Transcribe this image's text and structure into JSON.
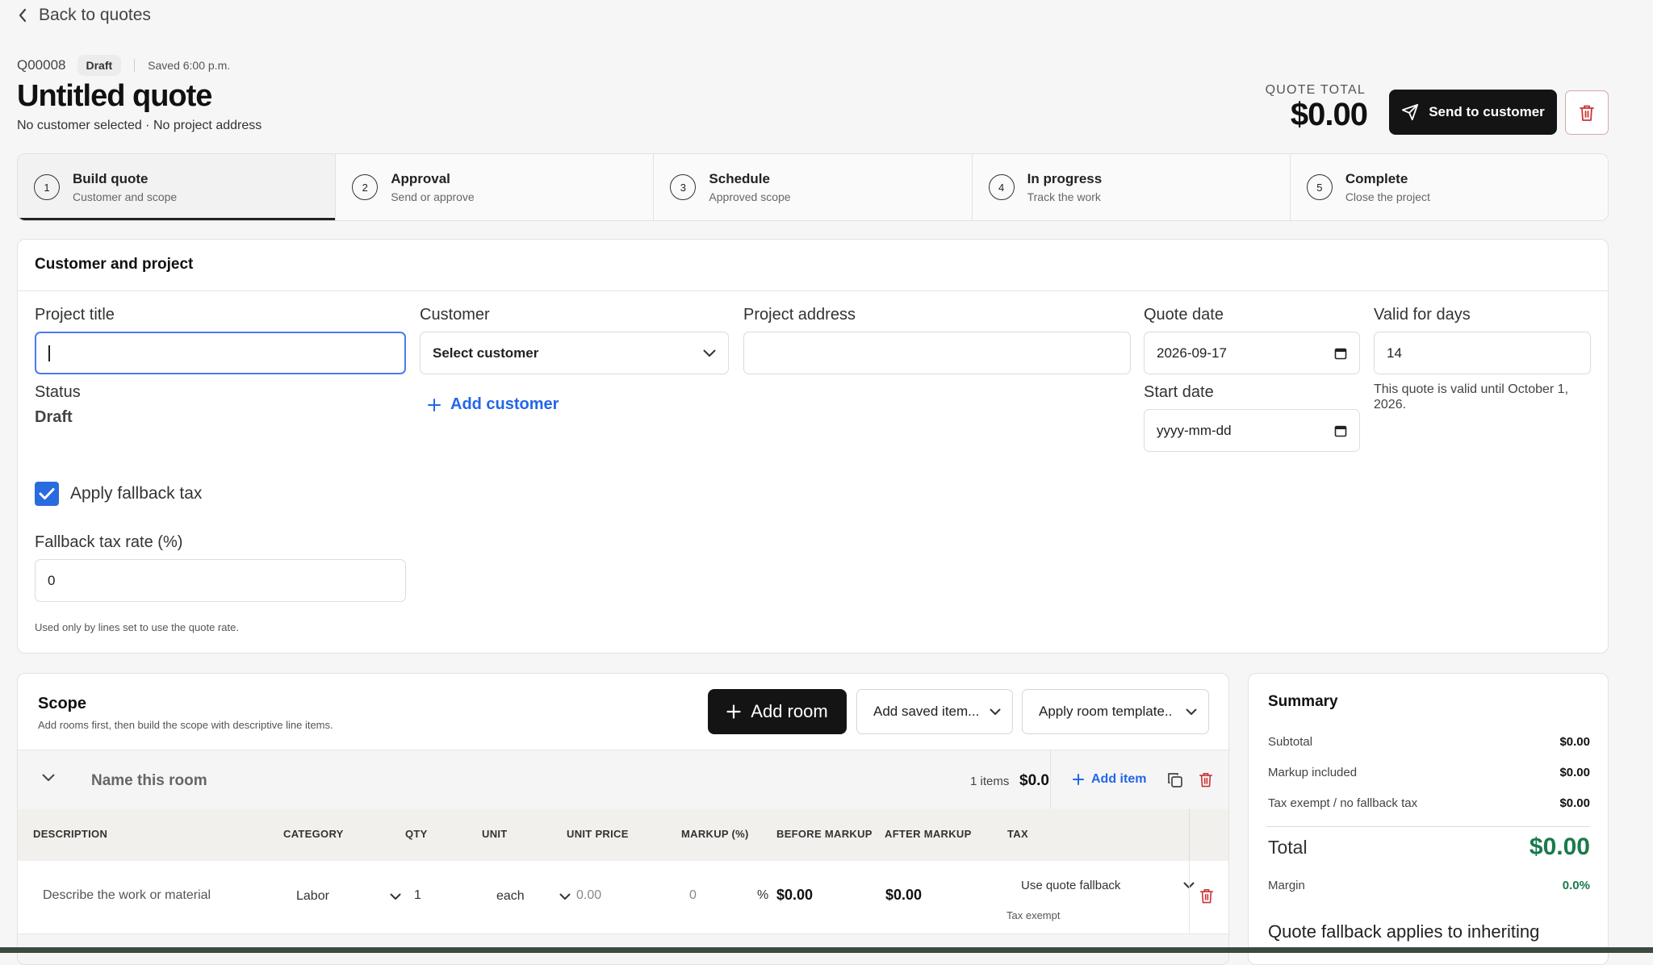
{
  "nav": {
    "back_label": "Back to quotes"
  },
  "quote": {
    "id": "Q00008",
    "status_badge": "Draft",
    "saved_text": "Saved 6:00 p.m.",
    "title": "Untitled quote",
    "subtitle": "No customer selected · No project address",
    "total_label": "QUOTE TOTAL",
    "total_value": "$0.00"
  },
  "actions": {
    "send_label": "Send to customer",
    "delete_icon": "trash-icon"
  },
  "steps": [
    {
      "num": "1",
      "title": "Build quote",
      "sub": "Customer and scope",
      "active": true
    },
    {
      "num": "2",
      "title": "Approval",
      "sub": "Send or approve"
    },
    {
      "num": "3",
      "title": "Schedule",
      "sub": "Approved scope"
    },
    {
      "num": "4",
      "title": "In progress",
      "sub": "Track the work"
    },
    {
      "num": "5",
      "title": "Complete",
      "sub": "Close the project"
    }
  ],
  "customer_card": {
    "heading": "Customer and project",
    "project_title_label": "Project title",
    "project_title_value": "",
    "customer_label": "Customer",
    "customer_value": "Select customer",
    "add_customer_label": "Add customer",
    "project_address_label": "Project address",
    "project_address_value": "",
    "quote_date_label": "Quote date",
    "quote_date_value": "2026-09-17",
    "valid_days_label": "Valid for days",
    "valid_days_value": "14",
    "valid_note": "This quote is valid until October 1, 2026.",
    "start_date_label": "Start date",
    "start_date_value": "yyyy-mm-dd",
    "status_label": "Status",
    "status_value": "Draft",
    "fallback_checkbox_label": "Apply fallback tax",
    "fallback_checked": true,
    "fallback_rate_label": "Fallback tax rate (%)",
    "fallback_rate_value": "0",
    "fallback_hint": "Used only by lines set to use the quote rate."
  },
  "scope": {
    "title": "Scope",
    "subtitle": "Add rooms first, then build the scope with descriptive line items.",
    "add_room_label": "Add room",
    "add_saved_label": "Add saved item...",
    "apply_template_label": "Apply room template..",
    "room": {
      "name_placeholder": "Name this room",
      "items_count": "1 items",
      "room_total": "$0.0",
      "add_item_label": "Add item"
    },
    "columns": [
      "DESCRIPTION",
      "CATEGORY",
      "QTY",
      "UNIT",
      "UNIT PRICE",
      "MARKUP (%)",
      "BEFORE MARKUP",
      "AFTER MARKUP",
      "TAX"
    ],
    "line": {
      "description_placeholder": "Describe the work or material",
      "category": "Labor",
      "qty": "1",
      "unit": "each",
      "unit_price_placeholder": "0.00",
      "markup_placeholder": "0",
      "percent": "%",
      "before_markup": "$0.00",
      "after_markup": "$0.00",
      "tax": "Use quote fallback",
      "tax_note": "Tax exempt"
    }
  },
  "summary": {
    "title": "Summary",
    "subtotal_label": "Subtotal",
    "subtotal_value": "$0.00",
    "markup_label": "Markup included",
    "markup_value": "$0.00",
    "exempt_label": "Tax exempt / no fallback tax",
    "exempt_value": "$0.00",
    "total_label": "Total",
    "total_value": "$0.00",
    "margin_label": "Margin",
    "margin_value": "0.0%",
    "fallback_note": "Quote fallback applies to inheriting",
    "accent_green": "#1a7a4c"
  }
}
